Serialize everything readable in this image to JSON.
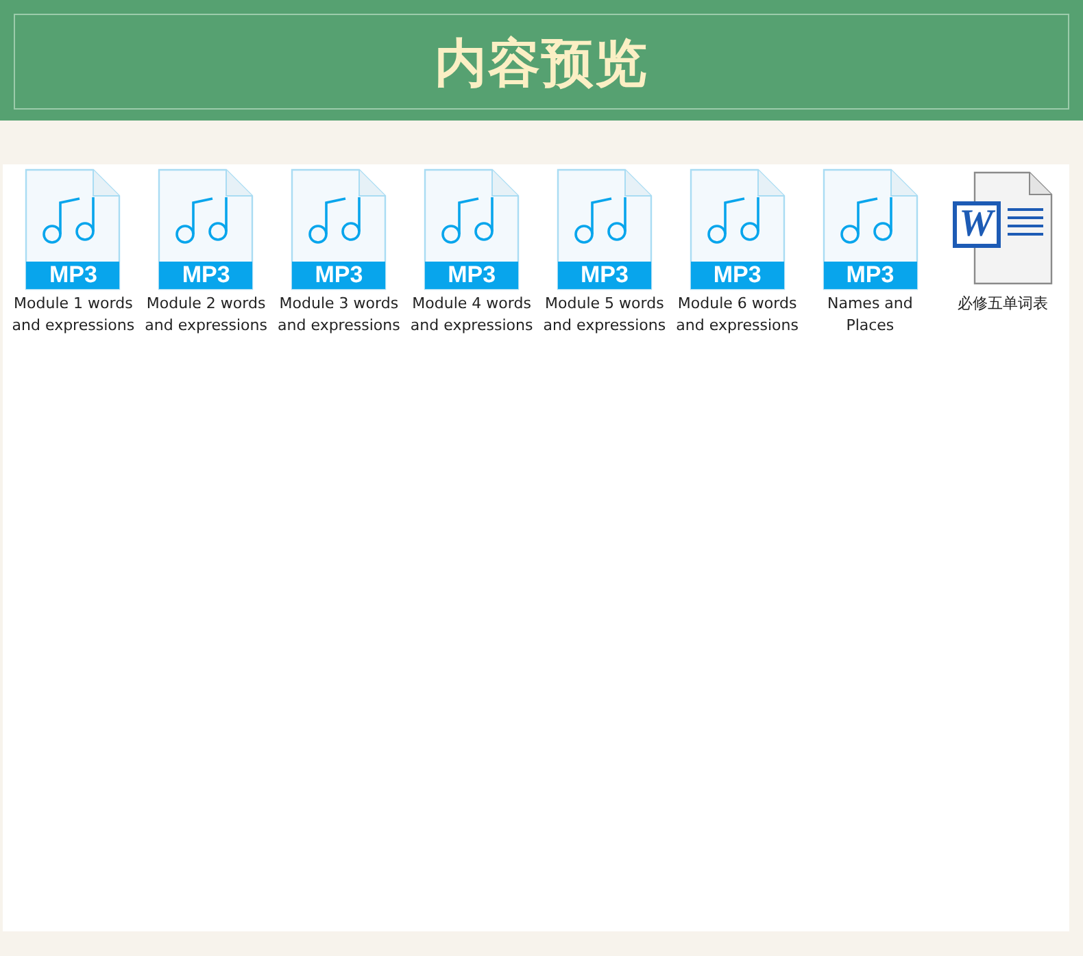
{
  "header": {
    "title": "内容预览"
  },
  "files": [
    {
      "kind": "mp3",
      "badge": "MP3",
      "name": "Module 1 words and expressions"
    },
    {
      "kind": "mp3",
      "badge": "MP3",
      "name": "Module 2 words and expressions"
    },
    {
      "kind": "mp3",
      "badge": "MP3",
      "name": "Module 3 words and expressions"
    },
    {
      "kind": "mp3",
      "badge": "MP3",
      "name": "Module 4 words and expressions"
    },
    {
      "kind": "mp3",
      "badge": "MP3",
      "name": "Module 5 words and expressions"
    },
    {
      "kind": "mp3",
      "badge": "MP3",
      "name": "Module 6 words and expressions"
    },
    {
      "kind": "mp3",
      "badge": "MP3",
      "name": "Names and Places"
    },
    {
      "kind": "word",
      "badge": "W",
      "name": "必修五单词表"
    }
  ]
}
